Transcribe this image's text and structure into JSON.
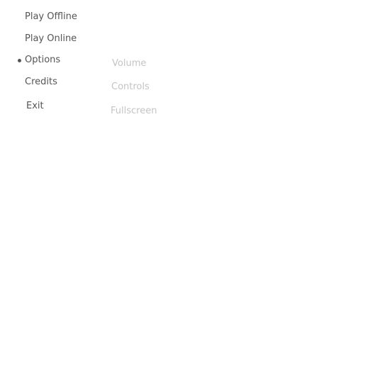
{
  "main_menu": {
    "items": [
      {
        "label": "Play Offline"
      },
      {
        "label": "Play Online"
      },
      {
        "label": "Options"
      },
      {
        "label": "Credits"
      },
      {
        "label": "Exit"
      }
    ],
    "selected": "Options"
  },
  "options_submenu": {
    "items": [
      {
        "label": "Volume"
      },
      {
        "label": "Controls"
      },
      {
        "label": "Fullscreen"
      }
    ]
  },
  "colors": {
    "background": "#ffffff",
    "menu_text": "#555555",
    "submenu_text": "#c4c4c4",
    "bullet": "#555555"
  },
  "icons": {
    "selection_marker": "bullet-icon"
  }
}
